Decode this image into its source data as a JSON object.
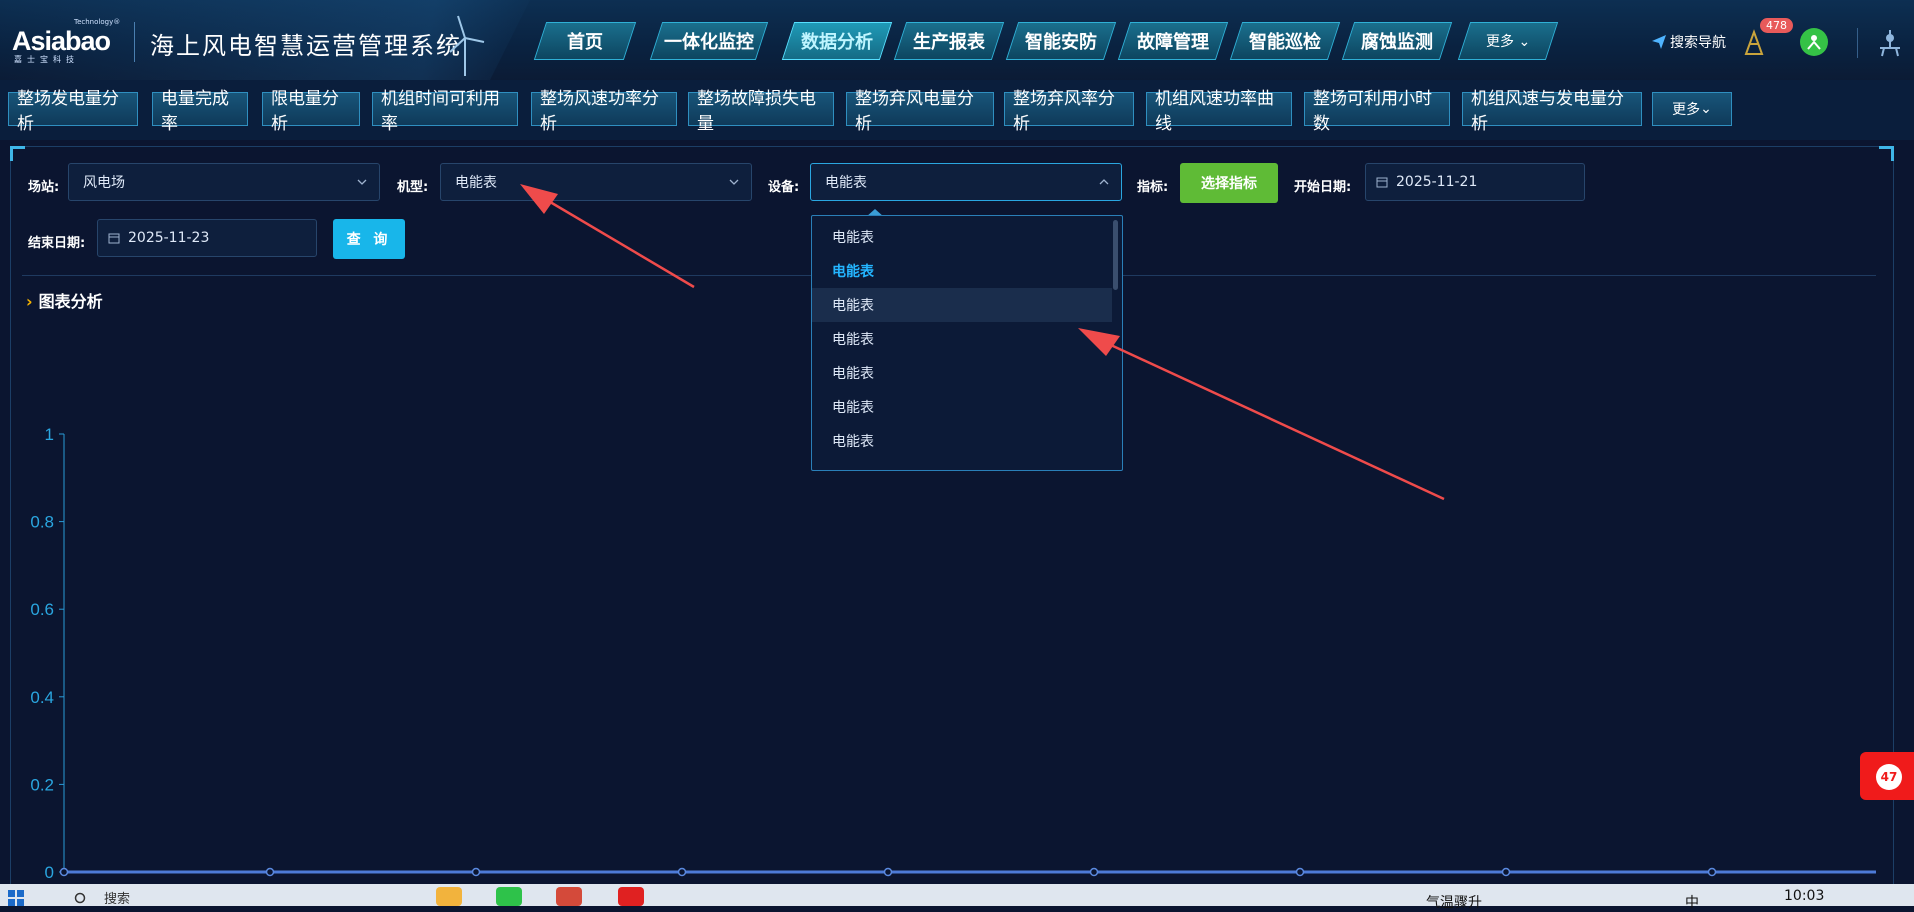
{
  "header": {
    "logo_text": "Asiabao",
    "logo_tech": "Technology®",
    "logo_cn": "嘉士宝科技",
    "system_title": "海上风电智慧运营管理系统",
    "search_nav": "搜索导航",
    "notification_count": "478"
  },
  "nav": {
    "items": [
      {
        "label": "首页"
      },
      {
        "label": "一体化监控"
      },
      {
        "label": "数据分析",
        "active": true
      },
      {
        "label": "生产报表"
      },
      {
        "label": "智能安防"
      },
      {
        "label": "故障管理"
      },
      {
        "label": "智能巡检"
      },
      {
        "label": "腐蚀监测"
      },
      {
        "label": "更多"
      }
    ]
  },
  "subnav": {
    "items": [
      "整场发电量分析",
      "电量完成率",
      "限电量分析",
      "机组时间可利用率",
      "整场风速功率分析",
      "整场故障损失电量",
      "整场弃风电量分析",
      "整场弃风率分析",
      "机组风速功率曲线",
      "整场可利用小时数",
      "机组风速与发电量分析",
      "更多"
    ]
  },
  "filters": {
    "station_label": "场站:",
    "station_value": "风电场",
    "model_label": "机型:",
    "model_value": "电能表",
    "device_label": "设备:",
    "device_value": "电能表",
    "indicator_label": "指标:",
    "indicator_button": "选择指标",
    "start_label": "开始日期:",
    "start_value": "2025-11-21",
    "end_label": "结束日期:",
    "end_value": "2025-11-23",
    "query_button": "查 询"
  },
  "section_title": "图表分析",
  "device_dropdown": {
    "options": [
      "电能表",
      "电能表",
      "电能表",
      "电能表",
      "电能表",
      "电能表",
      "电能表"
    ],
    "selected_index": 1,
    "hover_index": 2
  },
  "chart_data": {
    "type": "line",
    "y_ticks": [
      "1",
      "0.8",
      "0.6",
      "0.4",
      "0.2",
      "0"
    ],
    "ylim": [
      0,
      1
    ],
    "series": []
  },
  "taskbar": {
    "search_text": "搜索",
    "weather_text": "气温骤升",
    "tray_text": "中",
    "time": "10:03"
  },
  "floating_badge": "47",
  "colors": {
    "accent": "#24b5ff",
    "green_button": "#5fbb36",
    "query_button": "#18b6ea",
    "annotation_arrow": "#ef4b4b"
  }
}
